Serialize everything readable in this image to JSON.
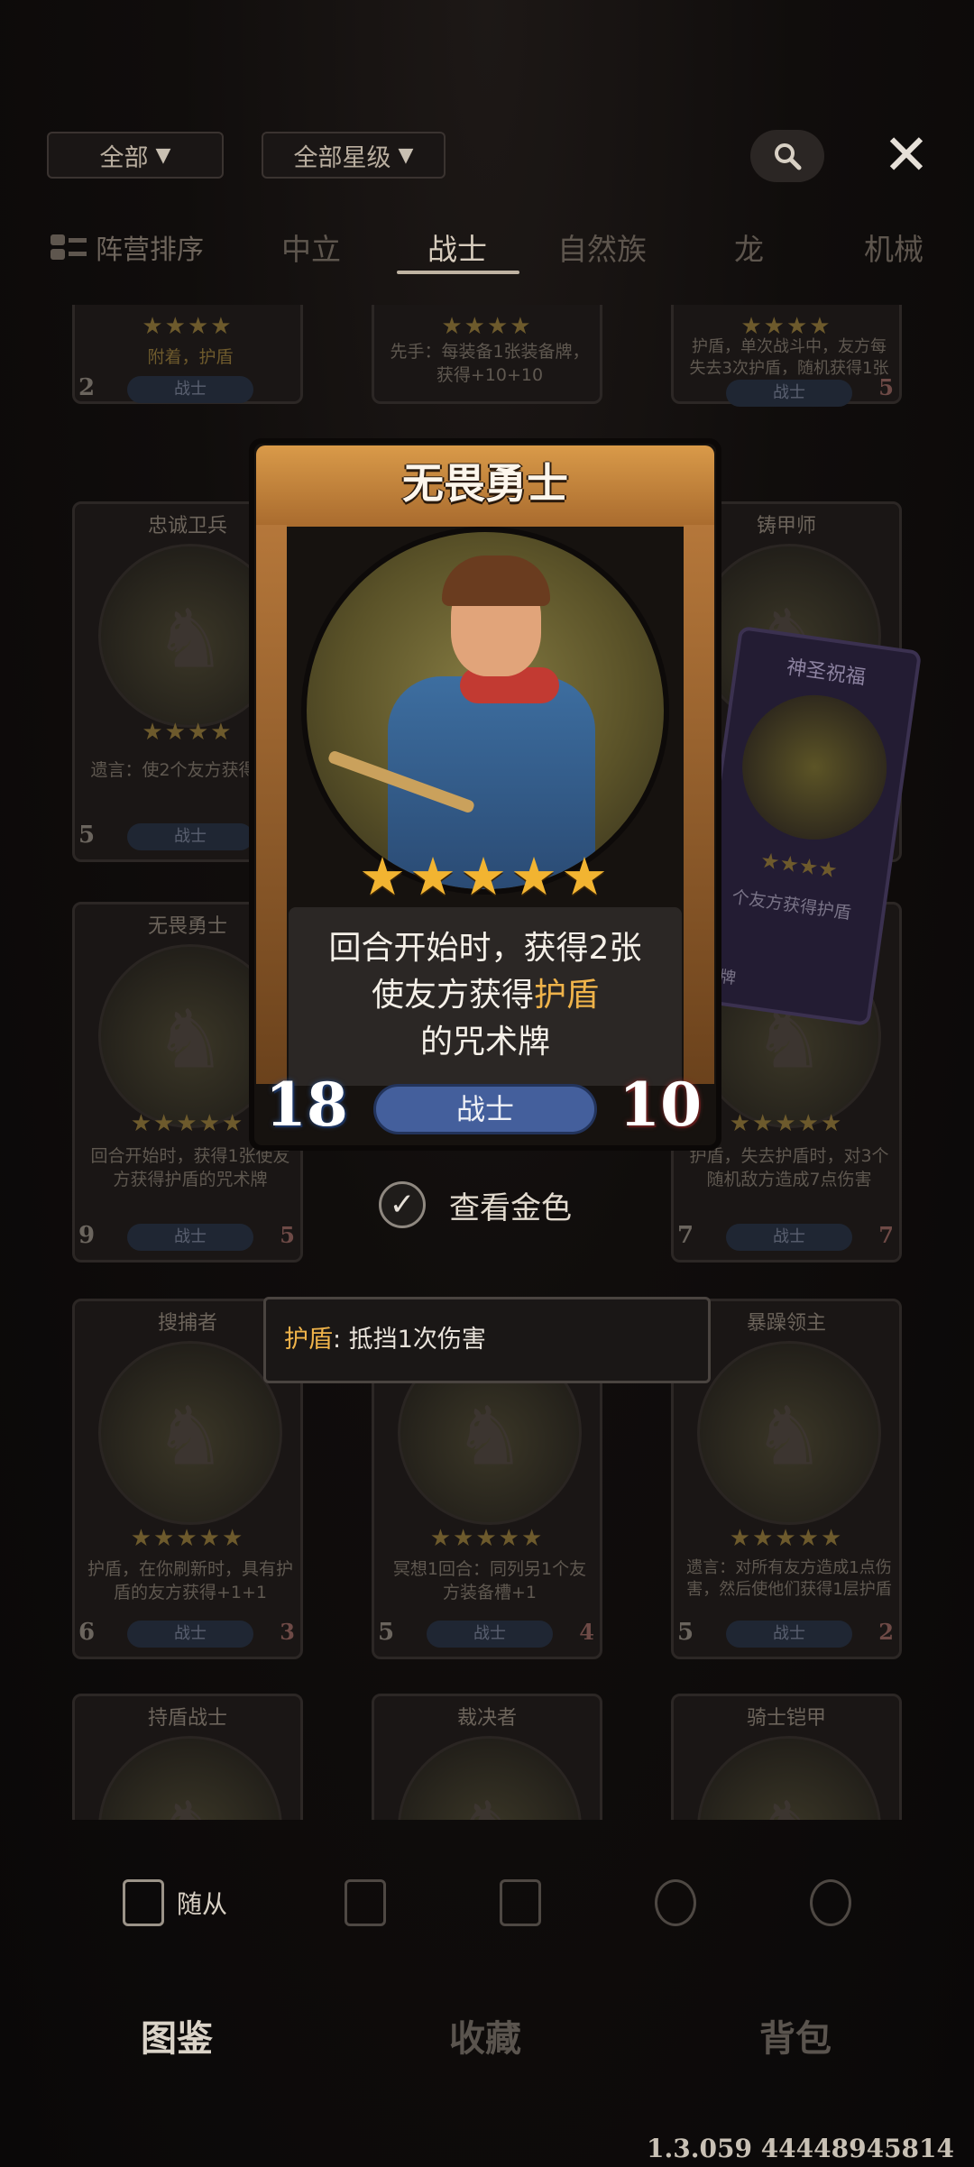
{
  "filters": {
    "faction": "全部",
    "stars": "全部星级"
  },
  "icons": {
    "dropdown": "triangle-down-icon",
    "search": "search-icon",
    "close": "close-icon",
    "check": "check-icon",
    "sort": "sort-icon"
  },
  "tabs": {
    "sort_label": "阵营排序",
    "items": [
      "中立",
      "战士",
      "自然族",
      "龙",
      "机械"
    ],
    "active": "战士"
  },
  "cards": [
    {
      "name": "",
      "desc": "附着，护盾",
      "race": "战士",
      "cost": "2",
      "atk": ""
    },
    {
      "name": "",
      "desc": "先手：每装备1张装备牌，获得+10+10",
      "race": "",
      "cost": "",
      "atk": ""
    },
    {
      "name": "",
      "desc": "护盾，单次战斗中，友方每失去3次护盾，随机获得1张入场牌",
      "race": "战士",
      "cost": "",
      "atk": "5"
    },
    {
      "name": "忠诚卫兵",
      "desc": "遗言：使2个友方获得护盾",
      "race": "战士",
      "cost": "5",
      "atk": ""
    },
    {
      "name": "铸甲师",
      "desc": "",
      "race": "",
      "cost": "",
      "atk": ""
    },
    {
      "name": "无畏勇士",
      "desc": "回合开始时，获得1张使友方获得护盾的咒术牌",
      "race": "战士",
      "cost": "9",
      "atk": "5"
    },
    {
      "name": "",
      "desc": "护盾，失去护盾时，对3个随机敌方造成7点伤害",
      "race": "战士",
      "cost": "7",
      "atk": "7"
    },
    {
      "name": "搜捕者",
      "desc": "护盾，在你刷新时，具有护盾的友方获得+1+1",
      "race": "战士",
      "cost": "6",
      "atk": "3"
    },
    {
      "name": "",
      "desc": "冥想1回合：同列另1个友方装备槽+1",
      "race": "战士",
      "cost": "5",
      "atk": "4"
    },
    {
      "name": "暴躁领主",
      "desc": "遗言：对所有友方造成1点伤害，然后使他们获得1层护盾",
      "race": "战士",
      "cost": "5",
      "atk": "2"
    },
    {
      "name": "持盾战士",
      "desc": "",
      "race": "",
      "cost": "",
      "atk": ""
    },
    {
      "name": "裁决者",
      "desc": "",
      "race": "",
      "cost": "",
      "atk": ""
    },
    {
      "name": "骑士铠甲",
      "desc": "",
      "race": "",
      "cost": "",
      "atk": ""
    }
  ],
  "spell_card": {
    "title": "神圣祝福",
    "desc": "个友方获得护盾",
    "type": "术牌"
  },
  "detail": {
    "title": "无畏勇士",
    "stars": 5,
    "desc_line1": "回合开始时，获得2张",
    "desc_line2_a": "使友方获得",
    "desc_line2_kw": "护盾",
    "desc_line3": "的咒术牌",
    "race": "战士",
    "cost": "18",
    "atk": "10"
  },
  "gold_toggle": {
    "label": "查看金色",
    "checked": true
  },
  "tooltip": {
    "keyword": "护盾",
    "text": ": 抵挡1次伤害"
  },
  "type_bar": {
    "items": [
      "随从",
      "",
      "",
      "",
      ""
    ],
    "active_label": "随从"
  },
  "nav": {
    "items": [
      "图鉴",
      "收藏",
      "背包"
    ],
    "active": "图鉴"
  },
  "version": "1.3.059 44448945814",
  "colors": {
    "gold": "#efb34a",
    "race_blue": "#445f9c",
    "header_orange": "#d99a49"
  }
}
